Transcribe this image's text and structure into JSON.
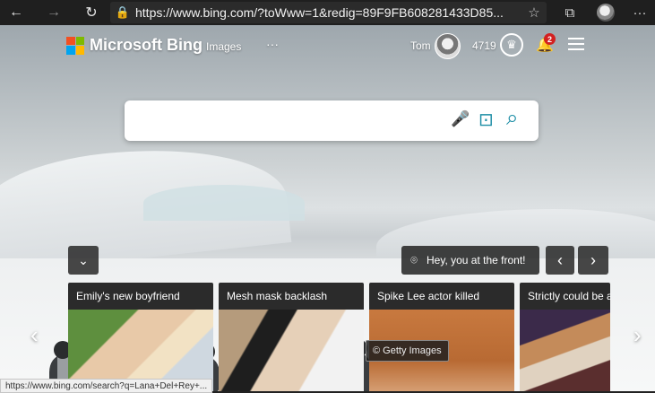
{
  "browser": {
    "back_icon": "←",
    "forward_icon": "→",
    "refresh_icon": "↻",
    "lock_icon": "🔒",
    "url": "https://www.bing.com/?toWww=1&redig=89F9FB608281433D85...",
    "favorite_icon": "☆",
    "collections_icon": "⧉",
    "more_icon": "···",
    "status_url": "https://www.bing.com/search?q=Lana+Del+Rey+..."
  },
  "header": {
    "brand": "Microsoft Bing",
    "images_link": "Images",
    "more_dots": "···",
    "user_name": "Tom",
    "rewards_points": "4719",
    "reward_icon": "♛",
    "notifications_count": "2",
    "bell_icon": "🔔"
  },
  "search": {
    "placeholder": "",
    "mic_icon": "🎤",
    "visual_search_icon": "⊡",
    "search_icon": "⌕"
  },
  "carousel": {
    "expand_icon": "⌄",
    "location_icon": "⌾",
    "caption": "Hey, you at the front!",
    "prev_icon": "‹",
    "next_icon": "›",
    "left_arrow": "‹",
    "right_arrow": "›",
    "credit": "© Getty Images",
    "cards": [
      {
        "title": "Emily's new boyfriend"
      },
      {
        "title": "Mesh mask backlash"
      },
      {
        "title": "Spike Lee actor killed"
      },
      {
        "title": "Strictly could be ax"
      }
    ]
  }
}
